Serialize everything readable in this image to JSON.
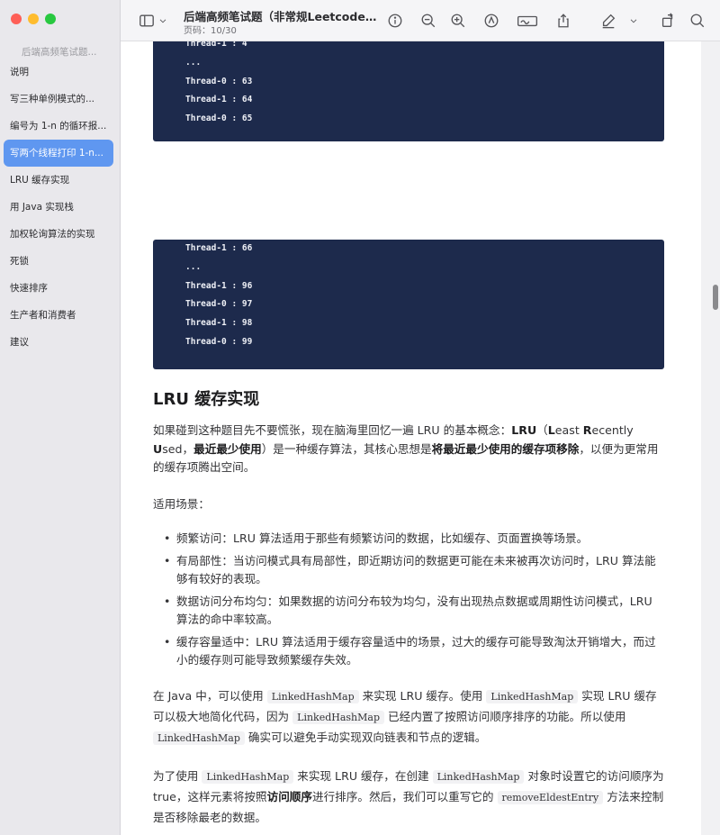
{
  "window": {
    "title": "后端高频笔试题（非常规Leetcode类）",
    "page_indicator": "页码：10/30"
  },
  "sidebar": {
    "section": "后端高频笔试题...",
    "items": [
      {
        "label": "说明"
      },
      {
        "label": "写三种单例模式的..."
      },
      {
        "label": "编号为 1-n 的循环报..."
      },
      {
        "label": "写两个线程打印 1-n...",
        "active": true
      },
      {
        "label": "LRU 缓存实现"
      },
      {
        "label": "用 Java 实现栈"
      },
      {
        "label": "加权轮询算法的实现"
      },
      {
        "label": "死锁"
      },
      {
        "label": "快速排序"
      },
      {
        "label": "生产者和消费者"
      },
      {
        "label": "建议"
      }
    ]
  },
  "toolbar": {
    "icons": [
      "sidebar-toggle-icon",
      "chevron-down-icon",
      "info-icon",
      "zoom-out-icon",
      "zoom-in-icon",
      "markup-icon",
      "signature-icon",
      "share-icon",
      "highlight-icon",
      "chevron-down-icon",
      "rotate-icon",
      "search-icon"
    ]
  },
  "page1": {
    "code_lines": [
      "Thread-1 : 4",
      "...",
      "Thread-0 : 63",
      "Thread-1 : 64",
      "Thread-0 : 65"
    ]
  },
  "page2": {
    "code_lines": [
      "Thread-1 : 66",
      "...",
      "Thread-1 : 96",
      "Thread-0 : 97",
      "Thread-1 : 98",
      "Thread-0 : 99"
    ],
    "heading": "LRU 缓存实现",
    "intro_1": "如果碰到这种题目先不要慌张，现在脑海里回忆一遍 LRU 的基本概念：",
    "intro_bold_1": "LRU",
    "intro_2": "（",
    "intro_bold_L": "L",
    "intro_3": "east ",
    "intro_bold_R": "R",
    "intro_4": "ecently ",
    "intro_bold_U": "U",
    "intro_5": "sed，",
    "intro_bold_2": "最近最少使用",
    "intro_6": "）是一种缓存算法，其核心思想是",
    "intro_bold_3": "将最近最少使用的缓存项移除",
    "intro_7": "，以便为更常用的缓存项腾出空间。",
    "scenario_label": "适用场景：",
    "bullets": [
      "频繁访问：LRU 算法适用于那些有频繁访问的数据，比如缓存、页面置换等场景。",
      "有局部性：当访问模式具有局部性，即近期访问的数据更可能在未来被再次访问时，LRU 算法能够有较好的表现。",
      "数据访问分布均匀：如果数据的访问分布较为均匀，没有出现热点数据或周期性访问模式，LRU 算法的命中率较高。",
      "缓存容量适中：LRU 算法适用于缓存容量适中的场景，过大的缓存可能导致淘汰开销增大，而过小的缓存则可能导致频繁缓存失效。"
    ],
    "p3_1": "在 Java 中，可以使用 ",
    "p3_code1": "LinkedHashMap",
    "p3_2": " 来实现 LRU 缓存。使用 ",
    "p3_code2": "LinkedHashMap",
    "p3_3": " 实现 LRU 缓存可以极大地简化代码，因为 ",
    "p3_code3": "LinkedHashMap",
    "p3_4": " 已经内置了按照访问顺序排序的功能。所以使用 ",
    "p3_code4": "LinkedHashMap",
    "p3_5": " 确实可以避免手动实现双向链表和节点的逻辑。",
    "p4_1": "为了使用 ",
    "p4_code1": "LinkedHashMap",
    "p4_2": " 来实现 LRU 缓存，在创建 ",
    "p4_code2": "LinkedHashMap",
    "p4_3": " 对象时设置它的访问顺序为 true，这样元素将按照",
    "p4_bold": "访问顺序",
    "p4_4": "进行排序。然后，我们可以重写它的 ",
    "p4_code3": "removeEldestEntry",
    "p4_5": " 方法来控制是否移除最老的数据。"
  }
}
